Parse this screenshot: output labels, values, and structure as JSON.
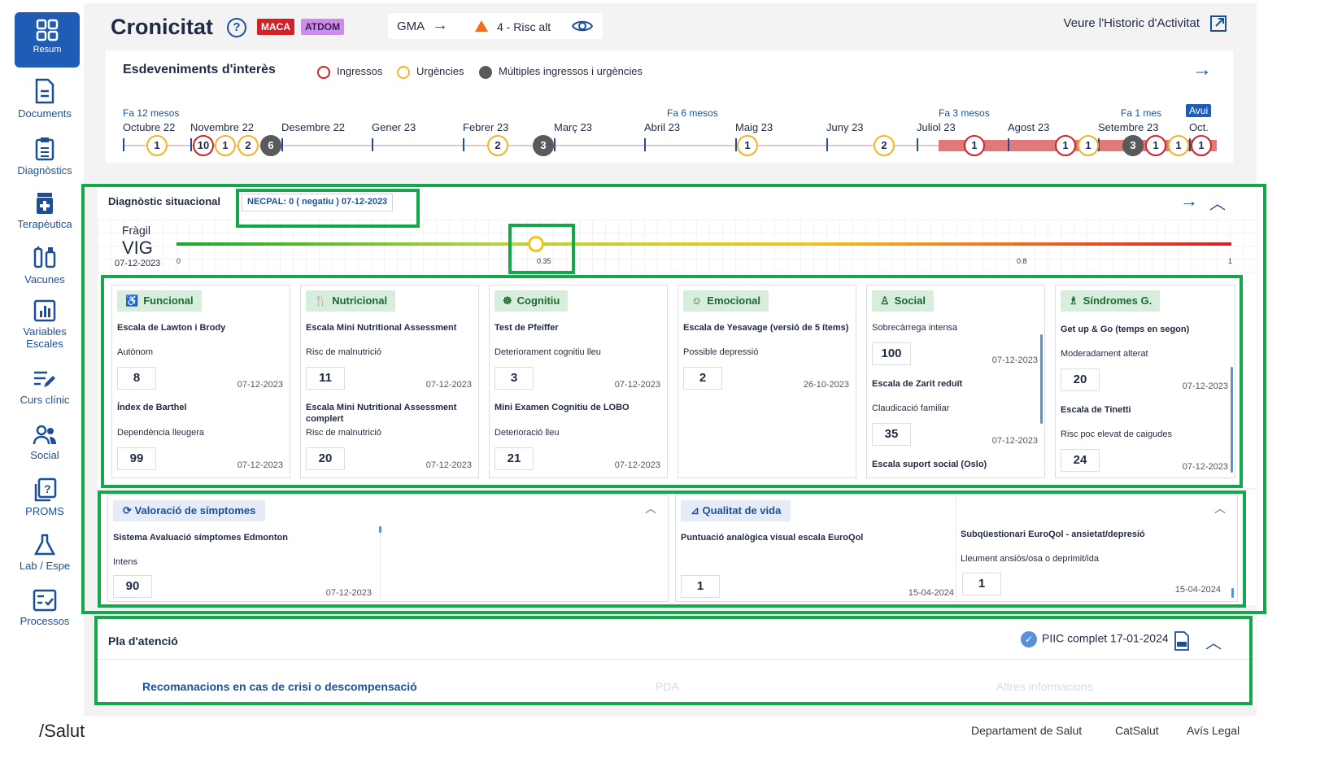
{
  "sidebar": {
    "items": [
      {
        "label": "Resum",
        "icon": "grid-icon"
      },
      {
        "label": "Documents",
        "icon": "document-icon"
      },
      {
        "label": "Diagnòstics",
        "icon": "clipboard-icon"
      },
      {
        "label": "Terapèutica",
        "icon": "medicine-icon"
      },
      {
        "label": "Vacunes",
        "icon": "vaccine-icon"
      },
      {
        "label": "Variables",
        "label2": "Escales",
        "icon": "chart-icon"
      },
      {
        "label": "Curs clínic",
        "icon": "edit-lines-icon"
      },
      {
        "label": "Social",
        "icon": "people-icon"
      },
      {
        "label": "PROMS",
        "icon": "question-doc-icon"
      },
      {
        "label": "Lab / Espe",
        "icon": "flask-icon"
      },
      {
        "label": "Processos",
        "icon": "checklist-icon"
      }
    ]
  },
  "header": {
    "title": "Cronicitat",
    "badge_maca": "MACA",
    "badge_atdom": "ATDOM",
    "gma": "GMA",
    "risk": "4 - Risc alt",
    "history": "Veure l'Historic d'Activitat"
  },
  "events": {
    "title": "Esdeveniments d'interès",
    "legend": {
      "ingressos": "Ingressos",
      "urgencies": "Urgències",
      "multiples": "Múltiples ingressos i urgències"
    },
    "relative": {
      "m12": "Fa 12 mesos",
      "m6": "Fa 6 mesos",
      "m3": "Fa 3 mesos",
      "m1": "Fa 1 mes"
    },
    "today": "Avui",
    "months": [
      "Octubre 22",
      "Novembre 22",
      "Desembre 22",
      "Gener 23",
      "Febrer 23",
      "Març 23",
      "Abril 23",
      "Maig 23",
      "Juny 23",
      "Juliol 23",
      "Agost 23",
      "Setembre 23",
      "Oct."
    ],
    "markers": [
      {
        "v": "1",
        "type": "urg"
      },
      {
        "v": "10",
        "type": "ing"
      },
      {
        "v": "1",
        "type": "urg"
      },
      {
        "v": "2",
        "type": "urg"
      },
      {
        "v": "6",
        "type": "mult"
      },
      {
        "v": "2",
        "type": "urg"
      },
      {
        "v": "3",
        "type": "mult"
      },
      {
        "v": "1",
        "type": "urg"
      },
      {
        "v": "2",
        "type": "urg"
      },
      {
        "v": "1",
        "type": "ing"
      },
      {
        "v": "1",
        "type": "ing"
      },
      {
        "v": "1",
        "type": "urg"
      },
      {
        "v": "3",
        "type": "mult"
      },
      {
        "v": "1",
        "type": "ing"
      },
      {
        "v": "1",
        "type": "urg"
      },
      {
        "v": "1",
        "type": "ing"
      }
    ],
    "colors": {
      "ingressos": "#d42027",
      "urgencies": "#f5b323",
      "multiples": "#5a5a5a"
    }
  },
  "diag": {
    "title": "Diagnòstic situacional",
    "necpal": "NECPAL: 0 ( negatiu ) 07-12-2023",
    "fragil": "Fràgil",
    "vig": "VIG",
    "vig_date": "07-12-2023",
    "scale": {
      "v0": "0",
      "v035": "0.35",
      "v08": "0.8",
      "v1": "1",
      "marker_value": 0.35
    }
  },
  "cards": {
    "funcional": {
      "tag": "Funcional",
      "s1": "Escala de Lawton i Brody",
      "r1": "Autònom",
      "v1": "8",
      "d1": "07-12-2023",
      "s2": "Índex de Barthel",
      "r2": "Dependència lleugera",
      "v2": "99",
      "d2": "07-12-2023"
    },
    "nutricional": {
      "tag": "Nutricional",
      "s1": "Escala Mini Nutritional Assessment",
      "r1": "Risc de malnutrició",
      "v1": "11",
      "d1": "07-12-2023",
      "s2": "Escala Mini Nutritional Assessment",
      "s2b": "complert",
      "r2": "Risc de malnutrició",
      "v2": "20",
      "d2": "07-12-2023"
    },
    "cognitiu": {
      "tag": "Cognitiu",
      "s1": "Test de Pfeiffer",
      "r1": "Deteriorament cognitiu lleu",
      "v1": "3",
      "d1": "07-12-2023",
      "s2": "Mini Examen Cognitiu de LOBO",
      "r2": "Deterioració lleu",
      "v2": "21",
      "d2": "07-12-2023"
    },
    "emocional": {
      "tag": "Emocional",
      "s1": "Escala de Yesavage (versió de 5 ítems)",
      "r1": "Possible depressió",
      "v1": "2",
      "d1": "26-10-2023"
    },
    "social": {
      "tag": "Social",
      "s1": "Sobrecàrrega intensa",
      "v1": "100",
      "d1": "07-12-2023",
      "s2": "Escala de Zarit reduït",
      "r2": "Claudicació familiar",
      "v2": "35",
      "d2": "07-12-2023",
      "s3": "Escala suport social (Oslo)"
    },
    "sindromes": {
      "tag": "Síndromes G.",
      "s1": "Get up & Go (temps en segon)",
      "r1": "Moderadament alterat",
      "v1": "20",
      "d1": "07-12-2023",
      "s2": "Escala de Tinetti",
      "r2": "Risc poc elevat de caigudes",
      "v2": "24",
      "d2": "07-12-2023"
    }
  },
  "symptoms": {
    "tag": "Valoració de símptomes",
    "s1": "Sistema Avaluació símptomes Edmonton",
    "r1": "Intens",
    "v1": "90",
    "d1": "07-12-2023"
  },
  "quality": {
    "tag": "Qualitat de vida",
    "s1": "Puntuació analògica visual escala EuroQol",
    "v1": "1",
    "d1": "15-04-2024",
    "s2": "Subqüestionari EuroQol - ansietat/depresió",
    "r2": "Lleument ansiós/osa o deprimit/ida",
    "v2": "1",
    "d2": "15-04-2024"
  },
  "pla": {
    "title": "Pla d'atenció",
    "piic": "PIIC complet",
    "piic_date": "17-01-2024",
    "tabs": [
      "Recomanacions en cas de crisi o descompensació",
      "PDA",
      "Altres informacions"
    ]
  },
  "footer": {
    "logo": "/Salut",
    "links": [
      "Departament de Salut",
      "CatSalut",
      "Avís Legal"
    ]
  }
}
